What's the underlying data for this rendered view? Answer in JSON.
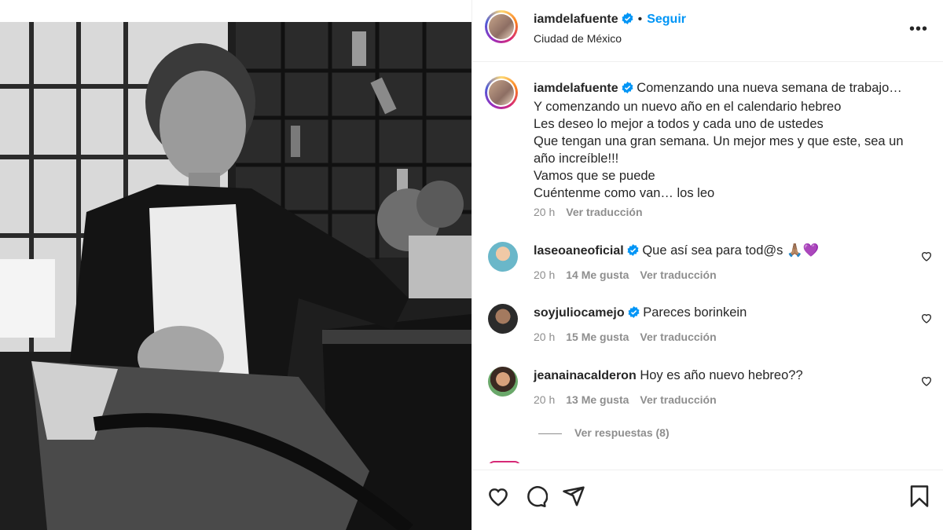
{
  "post": {
    "username": "iamdelafuente",
    "separator": "•",
    "follow_label": "Seguir",
    "location": "Ciudad de México",
    "more_label": "•••"
  },
  "caption": {
    "username": "iamdelafuente",
    "lines": [
      "Comenzando una nueva semana de trabajo…",
      "Y comenzando un nuevo año en el calendario hebreo",
      "Les deseo lo mejor a todos y cada uno de ustedes",
      "Que tengan una gran semana. Un mejor mes y que este, sea un año increíble!!!",
      "Vamos que se puede",
      "Cuéntenme como van… los leo"
    ],
    "time": "20 h",
    "translate": "Ver traducción"
  },
  "comments": [
    {
      "username": "laseoaneoficial",
      "text": "Que así sea para tod@s 🙏🏽💜",
      "time": "20 h",
      "likes": "14 Me gusta",
      "translate": "Ver traducción"
    },
    {
      "username": "soyjuliocamejo",
      "text": "Pareces borinkein",
      "time": "20 h",
      "likes": "15 Me gusta",
      "translate": "Ver traducción"
    },
    {
      "username": "jeanainacalderon",
      "text": "Hoy es año nuevo hebreo??",
      "time": "20 h",
      "likes": "13 Me gusta",
      "translate": "Ver traducción"
    }
  ],
  "replies_label": "Ver respuestas (8)",
  "icons": [
    "verified-badge-icon",
    "more-options-icon",
    "like-heart-icon",
    "comment-icon",
    "share-icon",
    "save-bookmark-icon"
  ],
  "colors": {
    "link_blue": "#0095f6",
    "muted": "#8e8e8e",
    "verified": "#0095f6"
  }
}
